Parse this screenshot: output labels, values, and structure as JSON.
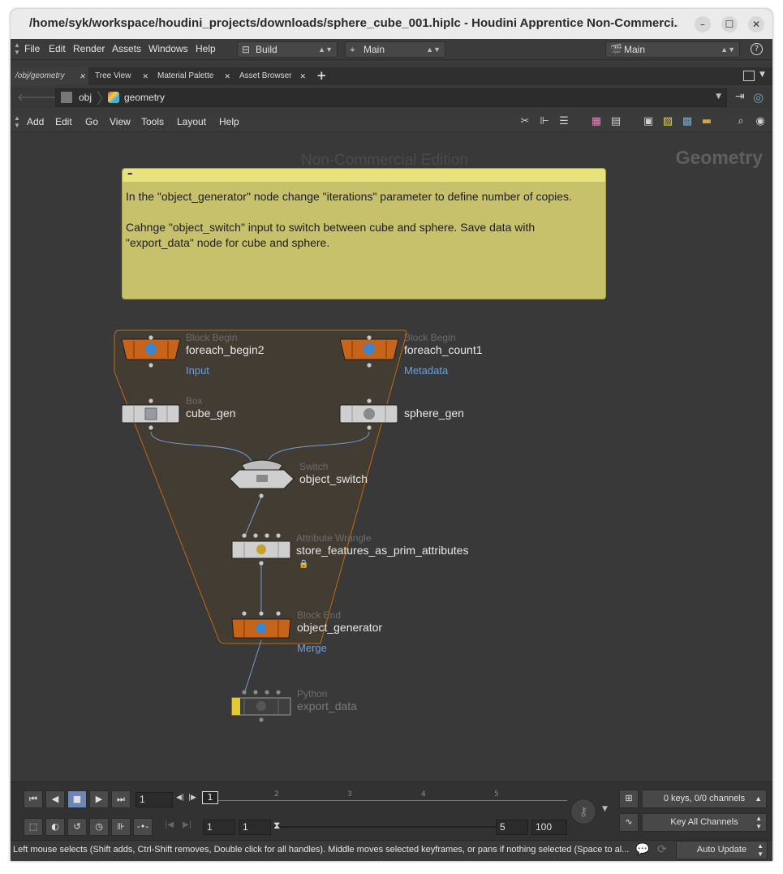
{
  "window": {
    "title": "/home/syk/workspace/houdini_projects/downloads/sphere_cube_001.hiplc - Houdini Apprentice Non-Commerci...",
    "controls": {
      "minimize": "–",
      "maximize": "☐",
      "close": "✕"
    }
  },
  "menubar": {
    "items": [
      "File",
      "Edit",
      "Render",
      "Assets",
      "Windows",
      "Help"
    ],
    "desktop_dropdown": "Build",
    "network_dropdown": "Main",
    "right_dropdown": "Main",
    "help_icon": "?"
  },
  "tabs": [
    {
      "label": "/obj/geometry",
      "active": true
    },
    {
      "label": "Tree View"
    },
    {
      "label": "Material Palette"
    },
    {
      "label": "Asset Browser"
    }
  ],
  "tab_add": "+",
  "path": {
    "root": "obj",
    "current": "geometry"
  },
  "network_menu": [
    "Add",
    "Edit",
    "Go",
    "View",
    "Tools",
    "Layout",
    "Help"
  ],
  "network": {
    "watermark": "Non-Commercial Edition",
    "context_label": "Geometry",
    "sticky_note": {
      "collapse_icon": "–",
      "lines": [
        "In the \"object_generator\" node change \"iterations\" parameter to define number of copies.",
        "Cahnge \"object_switch\" input to switch between cube and sphere. Save data with \"export_data\" node for cube and sphere."
      ]
    },
    "nodes": {
      "foreach_begin2": {
        "type": "Block Begin",
        "name": "foreach_begin2",
        "sub": "Input"
      },
      "foreach_count1": {
        "type": "Block Begin",
        "name": "foreach_count1",
        "sub": "Metadata"
      },
      "cube_gen": {
        "type": "Box",
        "name": "cube_gen"
      },
      "sphere_gen": {
        "type": "",
        "name": "sphere_gen"
      },
      "object_switch": {
        "type": "Switch",
        "name": "object_switch"
      },
      "store_features": {
        "type": "Attribute Wrangle",
        "name": "store_features_as_prim_attributes"
      },
      "object_generator": {
        "type": "Block End",
        "name": "object_generator",
        "sub": "Merge"
      },
      "export_data": {
        "type": "Python",
        "name": "export_data"
      }
    }
  },
  "playbar": {
    "frame": "1",
    "current_frame_marker": "1",
    "ticks": [
      "2",
      "3",
      "4",
      "5"
    ],
    "start": "1",
    "range_start": "1",
    "range_end": "5",
    "end": "100",
    "keys_info": "0 keys, 0/0 channels",
    "key_all": "Key All Channels"
  },
  "status": {
    "message": "Left mouse selects (Shift adds, Ctrl-Shift removes, Double click for all handles). Middle moves selected keyframes, or pans if nothing selected (Space to al...",
    "auto_update": "Auto Update"
  },
  "colors": {
    "background": "#393939",
    "sticky": "#c7c16c",
    "block_fill": "#4a4030",
    "block_border": "#c06a10",
    "block_node": "#c8641a",
    "wire": "#6f9fd8",
    "display_flag": "#e6c832"
  }
}
